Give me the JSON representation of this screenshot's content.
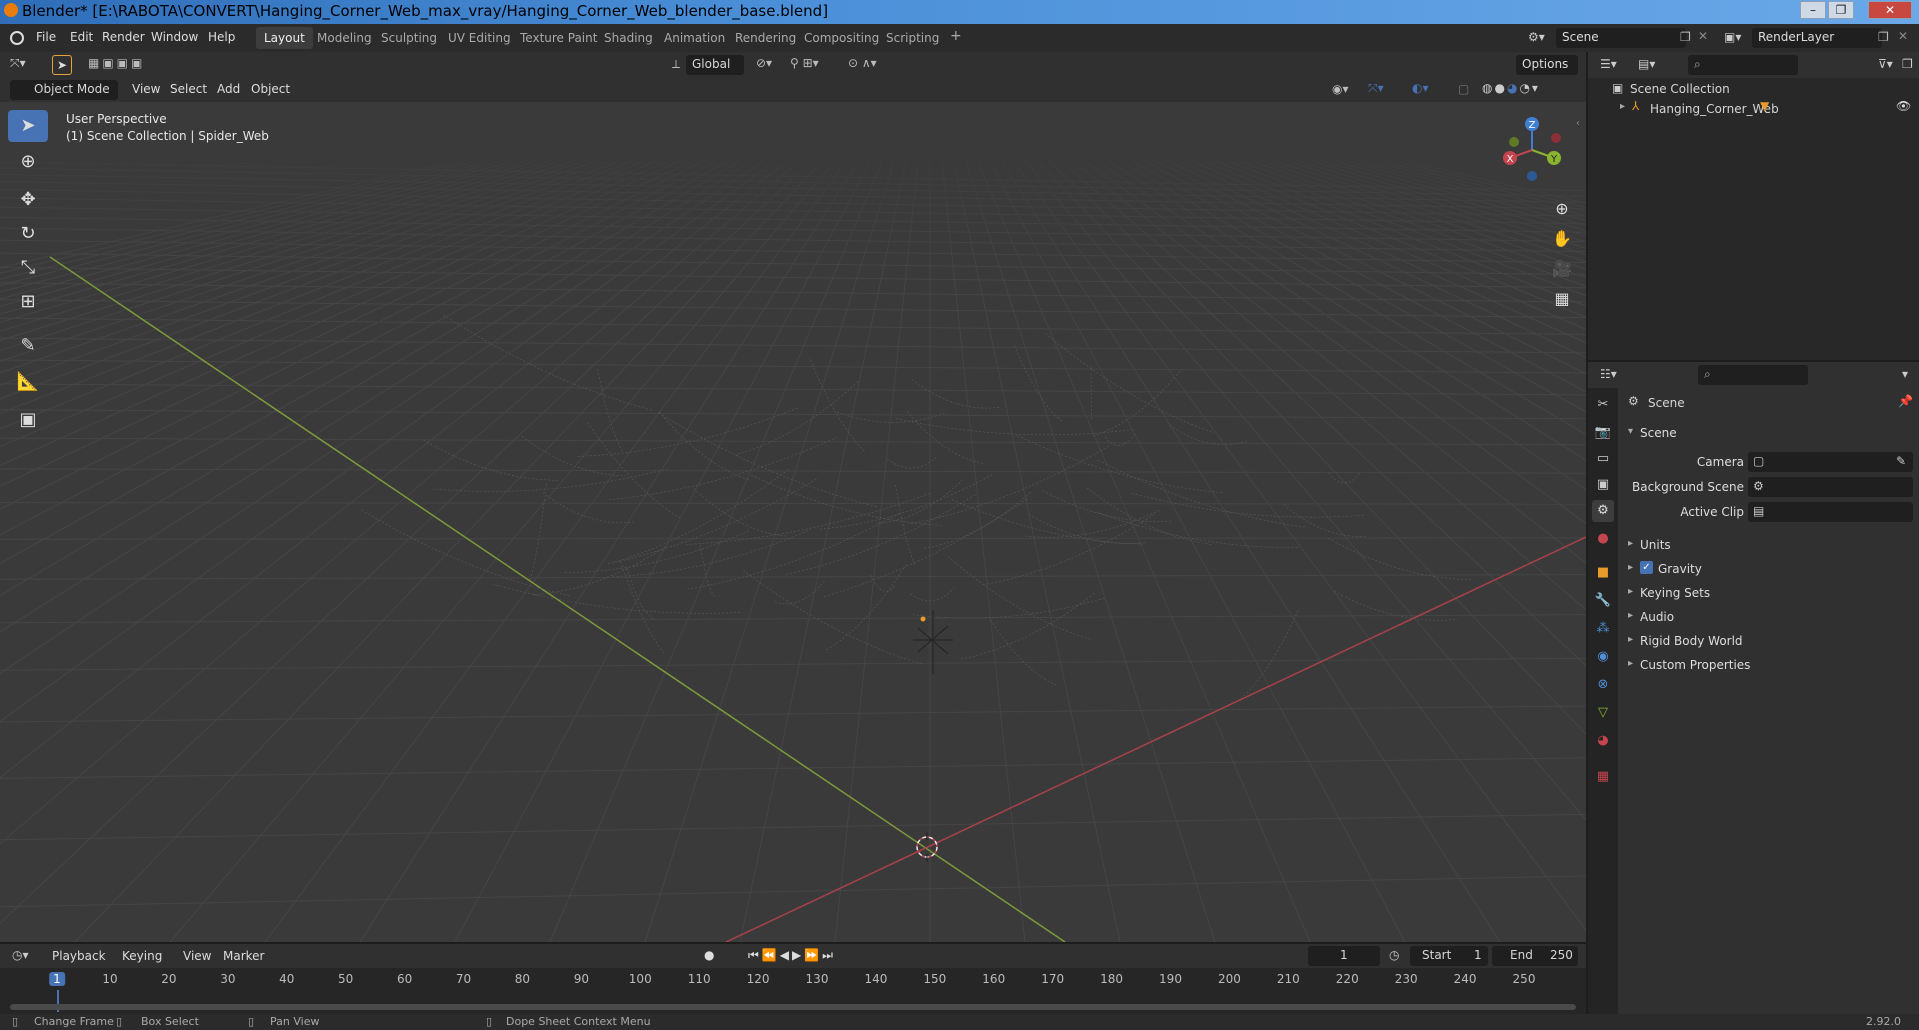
{
  "window": {
    "title": "Blender* [E:\\RABOTA\\CONVERT\\Hanging_Corner_Web_max_vray/Hanging_Corner_Web_blender_base.blend]"
  },
  "menu": {
    "items": [
      "File",
      "Edit",
      "Render",
      "Window",
      "Help"
    ]
  },
  "workspaces": [
    "Layout",
    "Modeling",
    "Sculpting",
    "UV Editing",
    "Texture Paint",
    "Shading",
    "Animation",
    "Rendering",
    "Compositing",
    "Scripting"
  ],
  "active_workspace": "Layout",
  "scene_name": "Scene",
  "render_layer": "RenderLayer",
  "tool_header": {
    "orientation": "Global",
    "options": "Options"
  },
  "view_header": {
    "mode": "Object Mode",
    "items": [
      "View",
      "Select",
      "Add",
      "Object"
    ]
  },
  "viewport": {
    "perspective": "User Perspective",
    "collection_info": "(1) Scene Collection | Spider_Web"
  },
  "gizmo": {
    "x": "X",
    "y": "Y",
    "z": "Z"
  },
  "outliner": {
    "root": "Scene Collection",
    "items": [
      "Hanging_Corner_Web"
    ]
  },
  "properties": {
    "header": "Scene",
    "panel": "Scene",
    "fields": [
      {
        "label": "Camera"
      },
      {
        "label": "Background Scene"
      },
      {
        "label": "Active Clip"
      }
    ],
    "sections": [
      "Units",
      "Gravity",
      "Keying Sets",
      "Audio",
      "Rigid Body World",
      "Custom Properties"
    ],
    "gravity_checked": true
  },
  "timeline": {
    "menus": [
      "Playback",
      "Keying",
      "View",
      "Marker"
    ],
    "current_frame": "1",
    "start_label": "Start",
    "start": "1",
    "end_label": "End",
    "end": "250",
    "ticks": [
      "1",
      "10",
      "20",
      "30",
      "40",
      "50",
      "60",
      "70",
      "80",
      "90",
      "100",
      "110",
      "120",
      "130",
      "140",
      "150",
      "160",
      "170",
      "180",
      "190",
      "200",
      "210",
      "220",
      "230",
      "240",
      "250"
    ]
  },
  "status": {
    "items": [
      "Change Frame",
      "Box Select",
      "Pan View",
      "Dope Sheet Context Menu"
    ],
    "version": "2.92.0"
  },
  "colors": {
    "accent": "#4772b3",
    "x_axis": "#c4454d",
    "y_axis": "#8ab32f",
    "z_axis": "#3f7fd1"
  }
}
